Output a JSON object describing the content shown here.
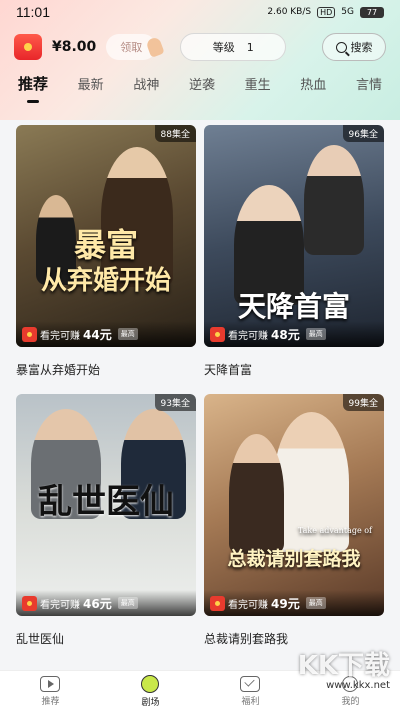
{
  "status_bar": {
    "time": "11:01",
    "signal_text": "2.60 KB/S",
    "network": "HD",
    "cell": "5G",
    "battery": "77"
  },
  "header": {
    "balance": "¥8.00",
    "claim_label": "领取",
    "level_label": "等级",
    "level_value": "1",
    "search_label": "搜索"
  },
  "tabs": [
    {
      "label": "推荐",
      "active": true
    },
    {
      "label": "最新",
      "active": false
    },
    {
      "label": "战神",
      "active": false
    },
    {
      "label": "逆袭",
      "active": false
    },
    {
      "label": "重生",
      "active": false
    },
    {
      "label": "热血",
      "active": false
    },
    {
      "label": "言情",
      "active": false
    }
  ],
  "dramas": [
    {
      "title": "暴富从弃婚开始",
      "cover_text_1": "暴富",
      "cover_text_2": "从弃婚开始",
      "episodes": "88集全",
      "earn_prefix": "看完可赚",
      "earn_amount": "44元",
      "tag": "最高"
    },
    {
      "title": "天降首富",
      "cover_text_1": "天降首富",
      "episodes": "96集全",
      "earn_prefix": "看完可赚",
      "earn_amount": "48元",
      "tag": "最高"
    },
    {
      "title": "乱世医仙",
      "cover_text_1": "乱世医仙",
      "episodes": "93集全",
      "earn_prefix": "看完可赚",
      "earn_amount": "46元",
      "tag": "最高"
    },
    {
      "title": "总裁请别套路我",
      "cover_text_1": "总裁请别套路我",
      "cover_text_2": "Take advantage of",
      "episodes": "99集全",
      "earn_prefix": "看完可赚",
      "earn_amount": "49元",
      "tag": "最高"
    }
  ],
  "bottom_nav": [
    {
      "label": "推荐",
      "icon": "play-icon",
      "active": false
    },
    {
      "label": "剧场",
      "icon": "theater-icon",
      "active": true
    },
    {
      "label": "福利",
      "icon": "mail-icon",
      "active": false
    },
    {
      "label": "我的",
      "icon": "profile-icon",
      "active": false
    }
  ],
  "watermark": {
    "brand": "KK下载",
    "url": "www.kkx.net"
  }
}
